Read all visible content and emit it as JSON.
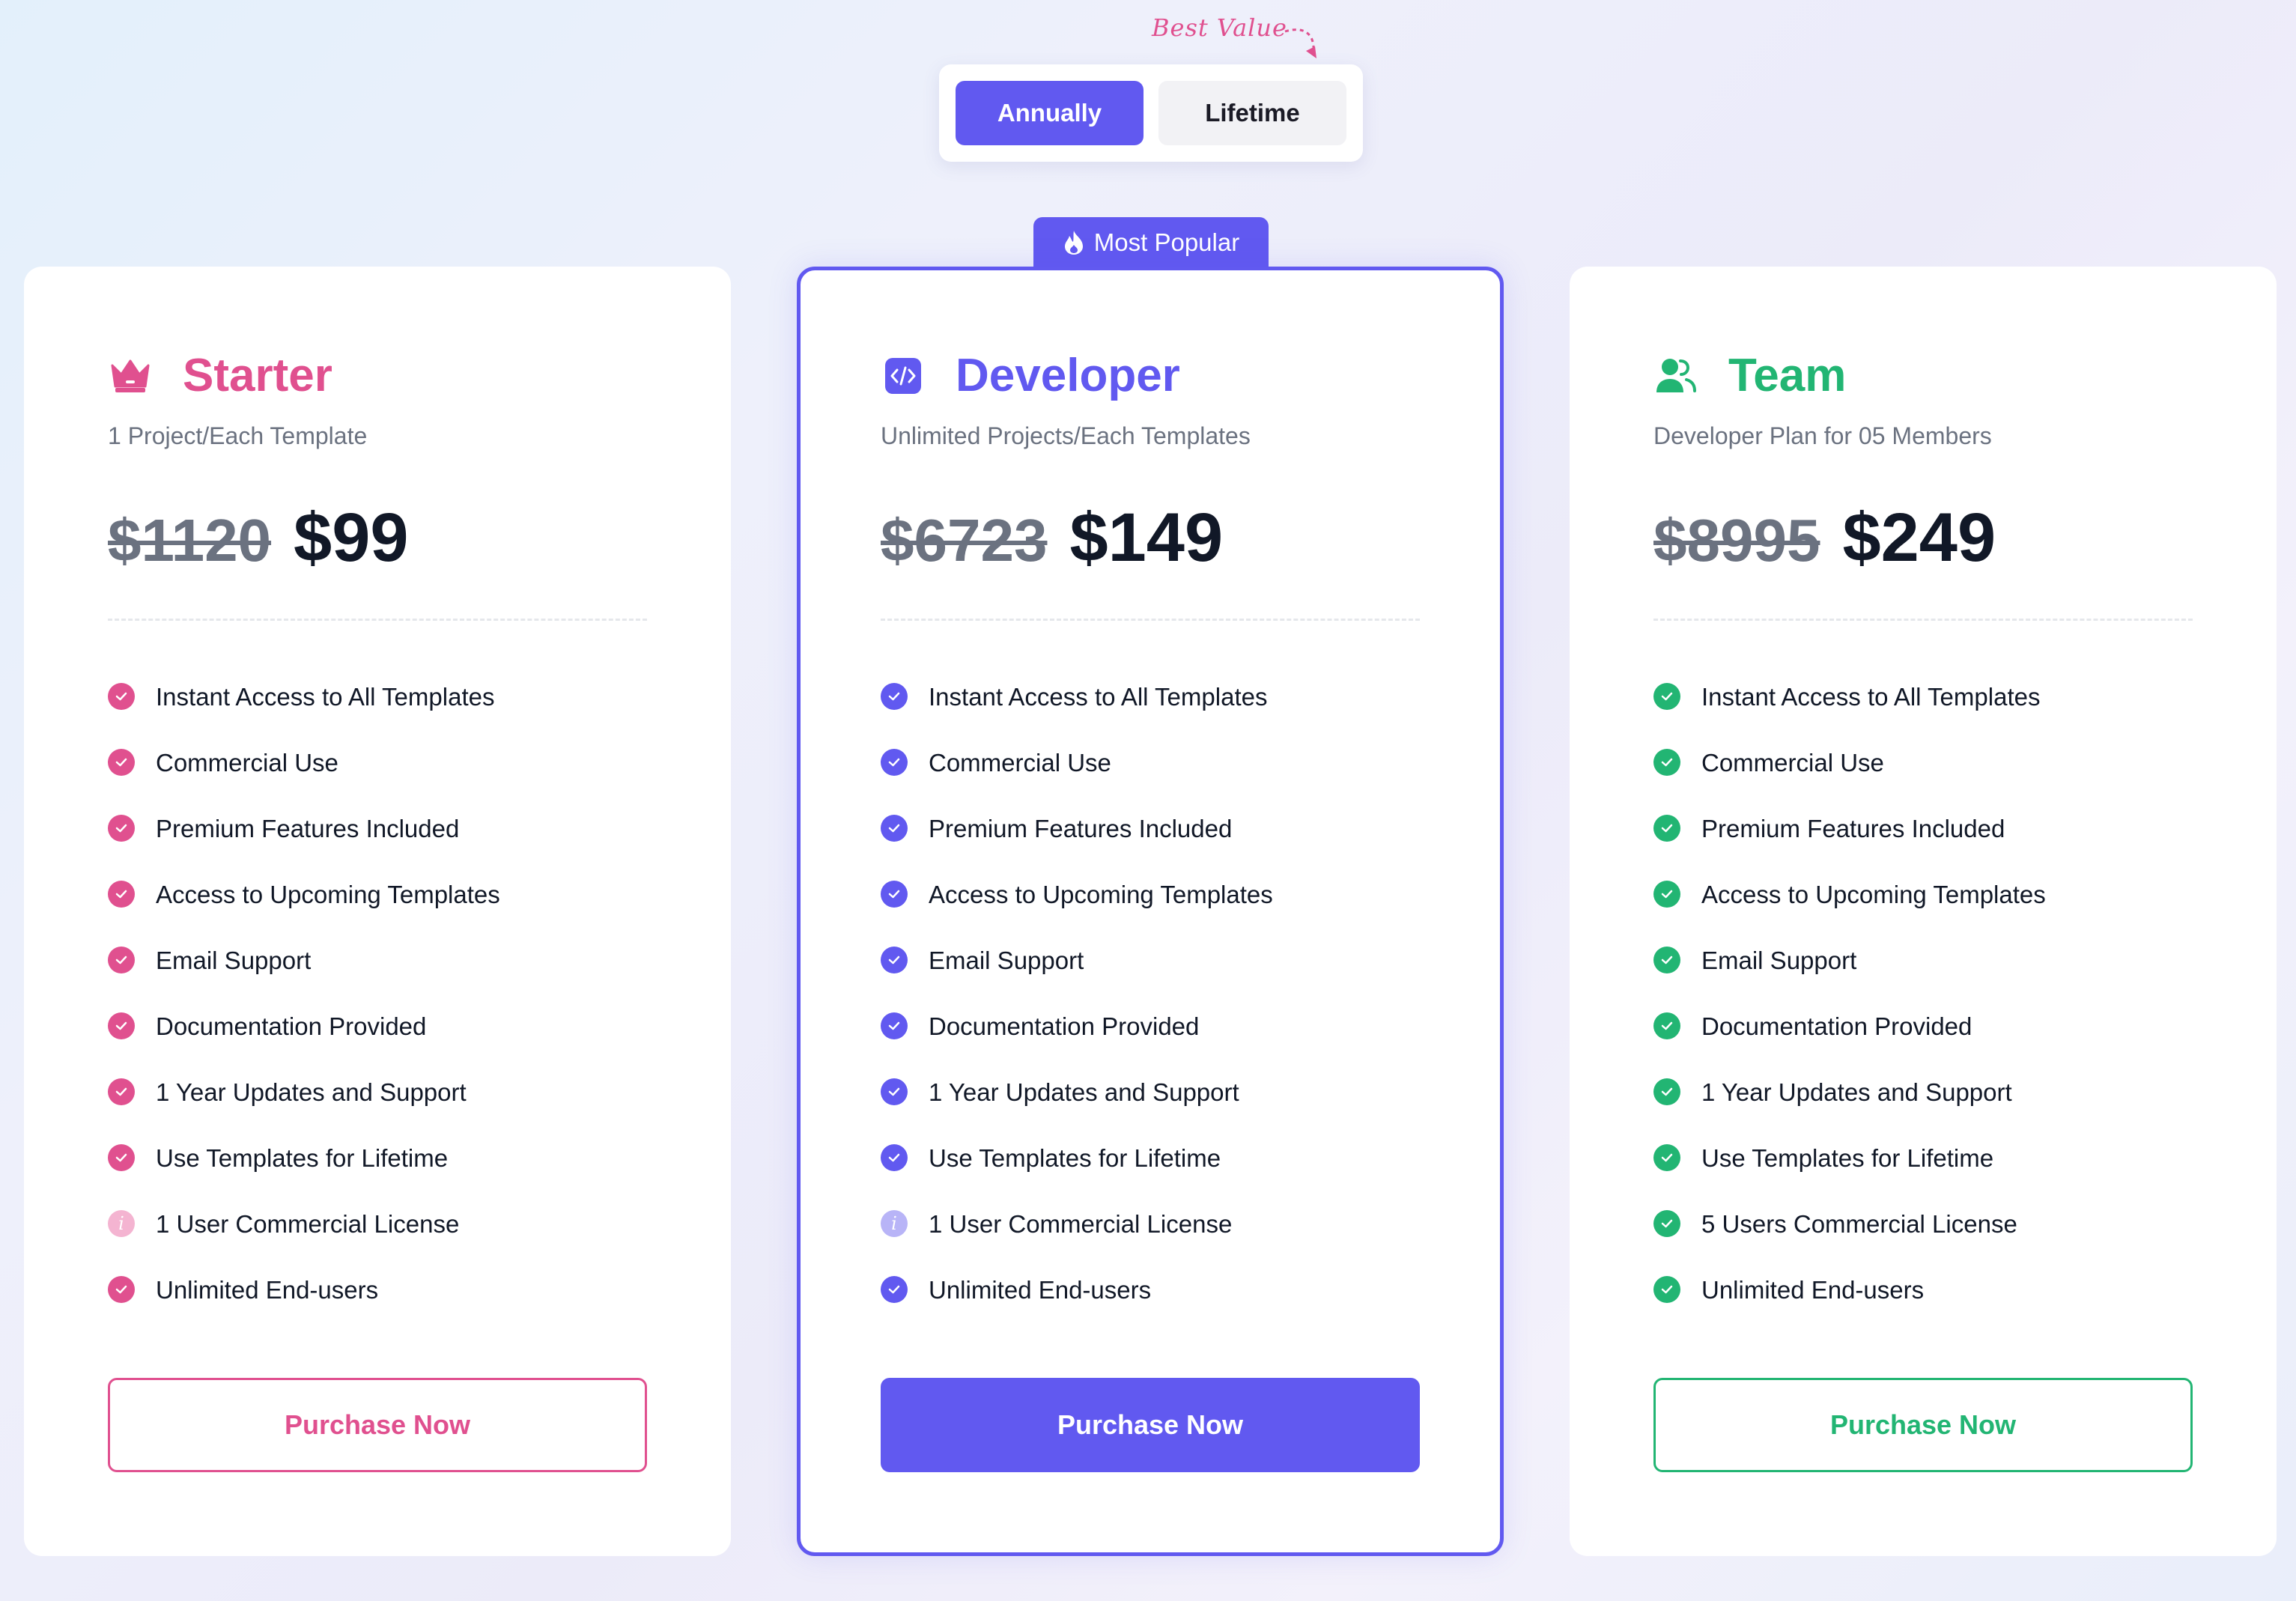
{
  "toggle": {
    "best_value": "Best Value",
    "options": [
      "Annually",
      "Lifetime"
    ],
    "selected": "Annually"
  },
  "badge": {
    "label": "Most Popular",
    "icon": "fire-icon"
  },
  "colors": {
    "starter": "#e0508f",
    "developer": "#6159f0",
    "team": "#22b573"
  },
  "plans": [
    {
      "name": "Starter",
      "icon": "crown-icon",
      "subtitle": "1 Project/Each Template",
      "old_price": "$1120",
      "price": "$99",
      "features": [
        {
          "text": "Instant Access to All Templates",
          "icon": "check-icon"
        },
        {
          "text": "Commercial Use",
          "icon": "check-icon"
        },
        {
          "text": "Premium Features Included",
          "icon": "check-icon"
        },
        {
          "text": "Access to Upcoming Templates",
          "icon": "check-icon"
        },
        {
          "text": "Email Support",
          "icon": "check-icon"
        },
        {
          "text": "Documentation Provided",
          "icon": "check-icon"
        },
        {
          "text": "1 Year Updates and Support",
          "icon": "check-icon"
        },
        {
          "text": "Use Templates for Lifetime",
          "icon": "check-icon"
        },
        {
          "text": "1 User Commercial License",
          "icon": "info-icon"
        },
        {
          "text": "Unlimited End-users",
          "icon": "check-icon"
        }
      ],
      "button": "Purchase Now"
    },
    {
      "name": "Developer",
      "icon": "code-icon",
      "subtitle": "Unlimited Projects/Each Templates",
      "old_price": "$6723",
      "price": "$149",
      "features": [
        {
          "text": "Instant Access to All Templates",
          "icon": "check-icon"
        },
        {
          "text": "Commercial Use",
          "icon": "check-icon"
        },
        {
          "text": "Premium Features Included",
          "icon": "check-icon"
        },
        {
          "text": "Access to Upcoming Templates",
          "icon": "check-icon"
        },
        {
          "text": "Email Support",
          "icon": "check-icon"
        },
        {
          "text": "Documentation Provided",
          "icon": "check-icon"
        },
        {
          "text": "1 Year Updates and Support",
          "icon": "check-icon"
        },
        {
          "text": "Use Templates for Lifetime",
          "icon": "check-icon"
        },
        {
          "text": "1 User Commercial License",
          "icon": "info-icon"
        },
        {
          "text": "Unlimited End-users",
          "icon": "check-icon"
        }
      ],
      "button": "Purchase Now"
    },
    {
      "name": "Team",
      "icon": "users-icon",
      "subtitle": "Developer Plan for 05 Members",
      "old_price": "$8995",
      "price": "$249",
      "features": [
        {
          "text": "Instant Access to All Templates",
          "icon": "check-icon"
        },
        {
          "text": "Commercial Use",
          "icon": "check-icon"
        },
        {
          "text": "Premium Features Included",
          "icon": "check-icon"
        },
        {
          "text": "Access to Upcoming Templates",
          "icon": "check-icon"
        },
        {
          "text": "Email Support",
          "icon": "check-icon"
        },
        {
          "text": "Documentation Provided",
          "icon": "check-icon"
        },
        {
          "text": "1 Year Updates and Support",
          "icon": "check-icon"
        },
        {
          "text": "Use Templates for Lifetime",
          "icon": "check-icon"
        },
        {
          "text": "5 Users Commercial License",
          "icon": "check-icon"
        },
        {
          "text": "Unlimited End-users",
          "icon": "check-icon"
        }
      ],
      "button": "Purchase Now"
    }
  ]
}
